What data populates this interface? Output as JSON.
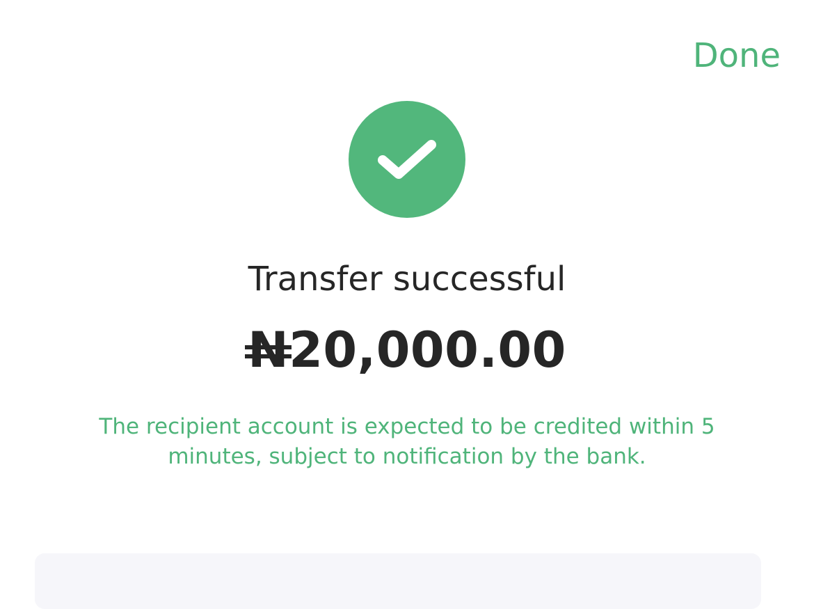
{
  "header": {
    "done_label": "Done"
  },
  "status": {
    "icon": "checkmark-circle-icon",
    "title": "Transfer successful"
  },
  "transfer": {
    "currency_symbol": "N",
    "amount": "20,000.00"
  },
  "note": "The recipient account is expected to be credited within 5 minutes, subject to notification by the bank.",
  "colors": {
    "accent_green": "#52b77c",
    "text_dark": "#262626",
    "card_background": "#f6f6fa"
  }
}
